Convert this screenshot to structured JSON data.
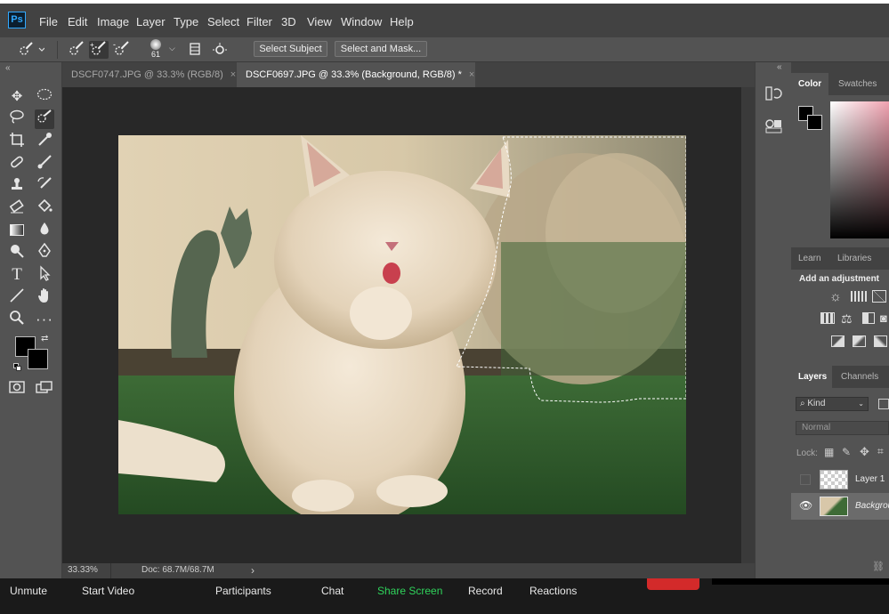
{
  "app": {
    "logo_text": "Ps"
  },
  "menu": [
    "File",
    "Edit",
    "Image",
    "Layer",
    "Type",
    "Select",
    "Filter",
    "3D",
    "View",
    "Window",
    "Help"
  ],
  "options_bar": {
    "brush_size": "61",
    "select_subject_label": "Select Subject",
    "select_and_mask_label": "Select and Mask..."
  },
  "tabs": [
    {
      "label": "DSCF0747.JPG @ 33.3% (RGB/8)",
      "close": "×",
      "active": false
    },
    {
      "label": "DSCF0697.JPG @ 33.3% (Background, RGB/8) *",
      "close": "×",
      "active": true
    }
  ],
  "panel_collapse_glyph": "«",
  "status": {
    "zoom": "33.33%",
    "doc": "Doc: 68.7M/68.7M",
    "arrow": "›"
  },
  "color_panel": {
    "tabs": [
      "Color",
      "Swatches"
    ],
    "active": "Color"
  },
  "learn_panel": {
    "tabs": [
      "Learn",
      "Libraries"
    ]
  },
  "adjustments": {
    "title": "Add an adjustment"
  },
  "layers_panel": {
    "tabs": [
      "Layers",
      "Channels"
    ],
    "filter_label": "Kind",
    "blend_mode": "Normal",
    "lock_label": "Lock:",
    "layers": [
      {
        "name": "Layer 1",
        "visible": false
      },
      {
        "name": "Background",
        "visible": true
      }
    ]
  },
  "meeting_bar": {
    "items": [
      "Unmute",
      "Start Video",
      "Participants",
      "Chat",
      "Share Screen",
      "Record",
      "Reactions"
    ],
    "highlight": "Share Screen",
    "highlight_color": "#2fd35b",
    "end_button_color": "#d32a2a"
  },
  "colors": {
    "ps_accent": "#31a8ff",
    "ui_dark": "#424242",
    "ui_mid": "#535353",
    "canvas_bg": "#282828"
  }
}
